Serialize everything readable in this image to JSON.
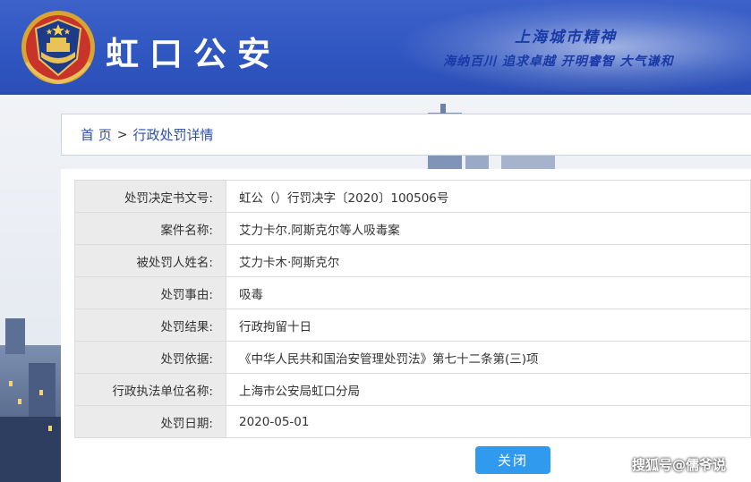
{
  "header": {
    "site_name": "虹口公安",
    "slogan_title": "上海城市精神",
    "slogan_line": "海纳百川 追求卓越 开明睿智 大气谦和"
  },
  "breadcrumb": {
    "home": "首 页",
    "separator": ">",
    "current": "行政处罚详情"
  },
  "details": {
    "rows": [
      {
        "label": "处罚决定书文号:",
        "value": "虹公（）行罚决字〔2020〕100506号"
      },
      {
        "label": "案件名称:",
        "value": "艾力卡尔.阿斯克尔等人吸毒案"
      },
      {
        "label": "被处罚人姓名:",
        "value": "艾力卡木·阿斯克尔"
      },
      {
        "label": "处罚事由:",
        "value": "吸毒"
      },
      {
        "label": "处罚结果:",
        "value": "行政拘留十日"
      },
      {
        "label": "处罚依据:",
        "value": "《中华人民共和国治安管理处罚法》第七十二条第(三)项"
      },
      {
        "label": "行政执法单位名称:",
        "value": "上海市公安局虹口分局"
      },
      {
        "label": "处罚日期:",
        "value": "2020-05-01"
      }
    ]
  },
  "actions": {
    "close_label": "关闭"
  },
  "watermark": "搜狐号@儒爷说",
  "colors": {
    "header_blue": "#2f55c0",
    "link_blue": "#2c4fa8",
    "button_blue": "#2f9aee",
    "label_bg": "#ebebeb"
  }
}
